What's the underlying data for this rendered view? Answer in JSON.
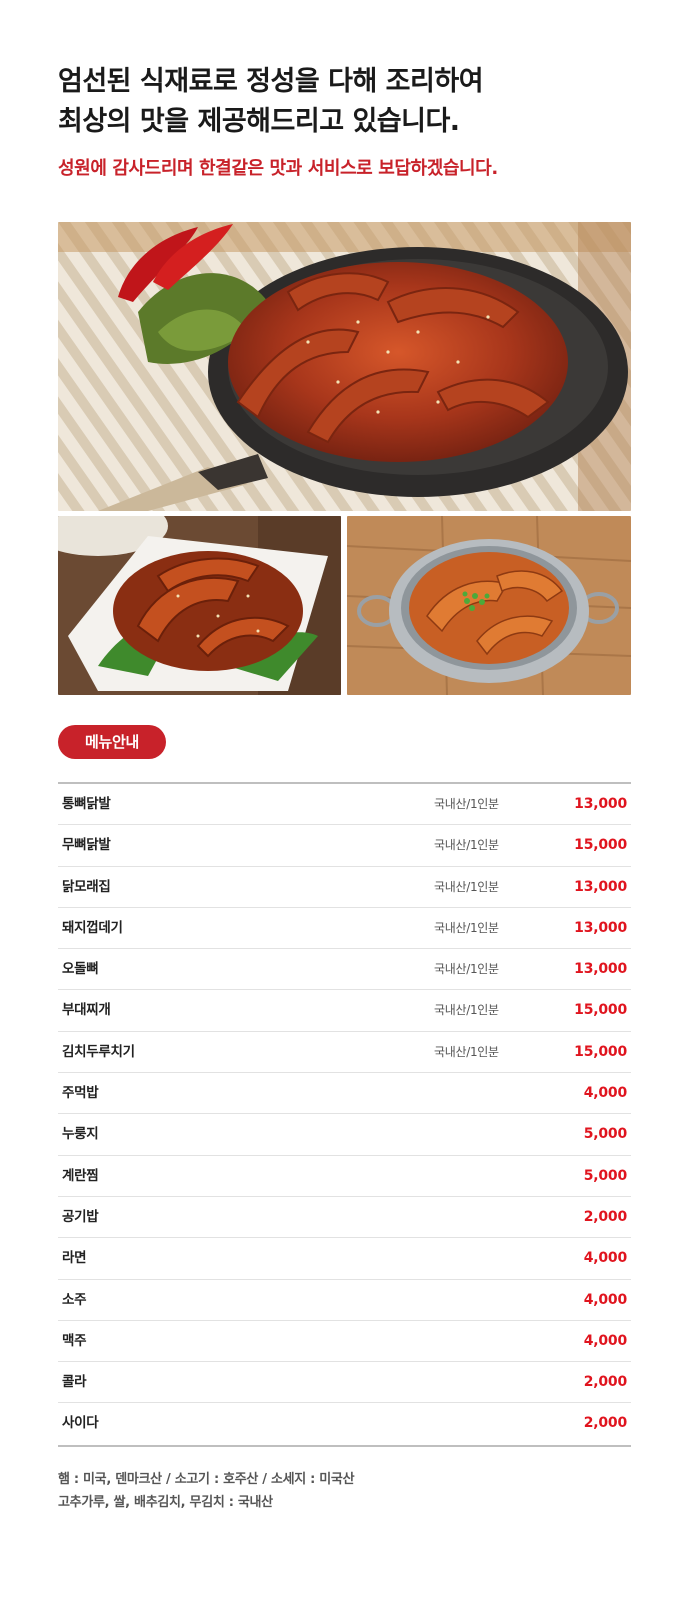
{
  "intro": {
    "line1": "엄선된 식재료로 정성을 다해 조리하여",
    "line2": "최상의 맛을 제공해드리고 있습니다.",
    "subline": "성원에 감사드리며 한결같은 맛과 서비스로 보답하겠습니다."
  },
  "images": {
    "hero": "chicken-feet-skillet-photo",
    "left": "spicy-chicken-dish-photo",
    "right": "stir-fried-dish-pan-photo"
  },
  "menu": {
    "badge_label": "메뉴안내",
    "items": [
      {
        "name": "통뼈닭발",
        "origin": "국내산/1인분",
        "price": "13,000"
      },
      {
        "name": "무뼈닭발",
        "origin": "국내산/1인분",
        "price": "15,000"
      },
      {
        "name": "닭모래집",
        "origin": "국내산/1인분",
        "price": "13,000"
      },
      {
        "name": "돼지껍데기",
        "origin": "국내산/1인분",
        "price": "13,000"
      },
      {
        "name": "오돌뼈",
        "origin": "국내산/1인분",
        "price": "13,000"
      },
      {
        "name": "부대찌개",
        "origin": "국내산/1인분",
        "price": "15,000"
      },
      {
        "name": "김치두루치기",
        "origin": "국내산/1인분",
        "price": "15,000"
      },
      {
        "name": "주먹밥",
        "origin": "",
        "price": "4,000"
      },
      {
        "name": "누룽지",
        "origin": "",
        "price": "5,000"
      },
      {
        "name": "계란찜",
        "origin": "",
        "price": "5,000"
      },
      {
        "name": "공기밥",
        "origin": "",
        "price": "2,000"
      },
      {
        "name": "라면",
        "origin": "",
        "price": "4,000"
      },
      {
        "name": "소주",
        "origin": "",
        "price": "4,000"
      },
      {
        "name": "맥주",
        "origin": "",
        "price": "4,000"
      },
      {
        "name": "콜라",
        "origin": "",
        "price": "2,000"
      },
      {
        "name": "사이다",
        "origin": "",
        "price": "2,000"
      }
    ]
  },
  "notes": {
    "line1": "햄 : 미국, 덴마크산 / 소고기 : 호주산 / 소세지 : 미국산",
    "line2": "고추가루, 쌀, 배추김치, 무김치 : 국내산"
  },
  "colors": {
    "accent": "#c8222a",
    "price": "#e0141e"
  }
}
